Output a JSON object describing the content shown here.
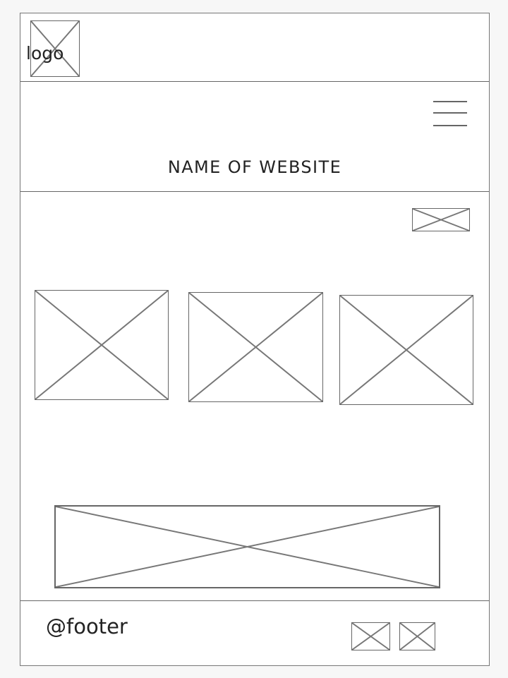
{
  "header": {
    "logo_label": "logo",
    "menu_icon": "hamburger-menu-icon",
    "site_title": "NAME OF WEBSITE"
  },
  "content": {
    "top_right_image_icon": "image-placeholder-icon",
    "gallery_items": [
      "image-placeholder-icon",
      "image-placeholder-icon",
      "image-placeholder-icon"
    ],
    "banner_icon": "image-placeholder-icon"
  },
  "footer": {
    "text": "@footer",
    "icons": [
      "image-placeholder-icon",
      "image-placeholder-icon"
    ]
  }
}
